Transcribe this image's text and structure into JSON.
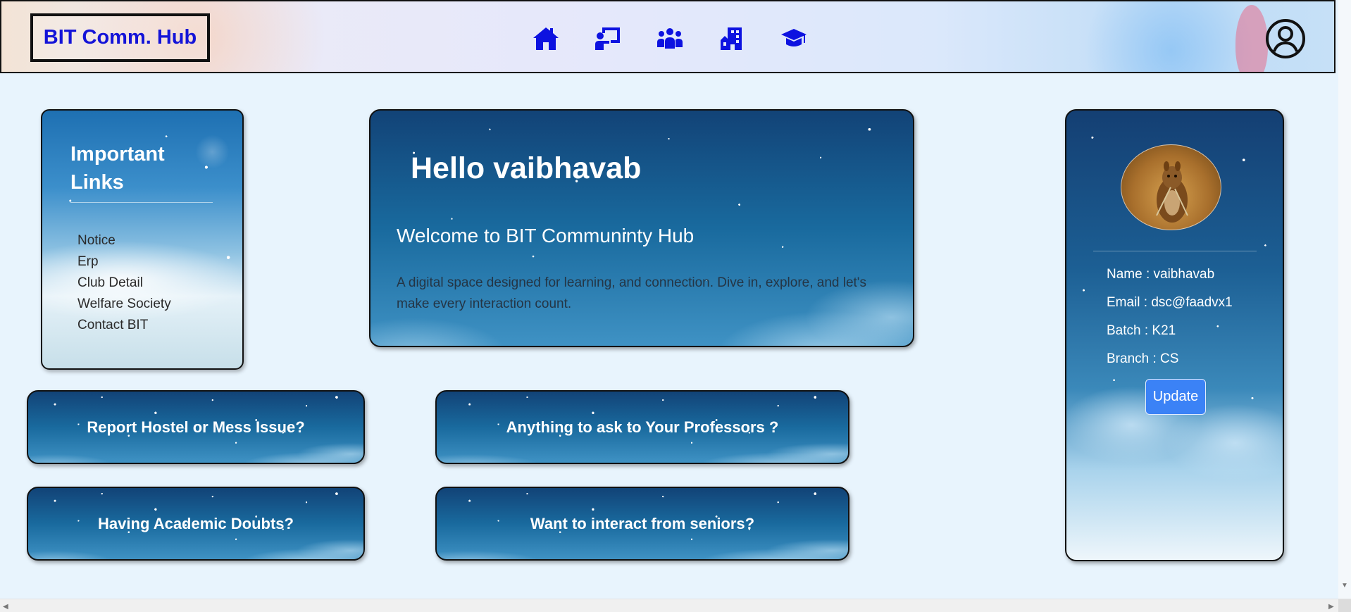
{
  "header": {
    "logo": "BIT Comm. Hub",
    "nav_icons": [
      "home-icon",
      "teacher-board-icon",
      "community-icon",
      "building-icon",
      "graduation-cap-icon"
    ],
    "profile_icon": "user-circle-icon"
  },
  "important_links": {
    "title": "Important Links",
    "items": [
      "Notice",
      "Erp",
      "Club Detail",
      "Welfare Society",
      "Contact BIT"
    ]
  },
  "hello": {
    "greeting": "Hello vaibhavab",
    "welcome": "Welcome to BIT Communinty Hub",
    "description": "A digital space designed for learning, and connection. Dive in, explore, and let's make every interaction count."
  },
  "actions": [
    "Report Hostel or Mess Issue?",
    "Anything to ask to Your Professors ?",
    "Having Academic Doubts?",
    "Want to interact from seniors?"
  ],
  "profile": {
    "name": "Name : vaibhavab",
    "email": "Email : dsc@faadvx1",
    "batch": "Batch : K21",
    "branch": "Branch : CS",
    "update_label": "Update"
  },
  "colors": {
    "logo_text": "#1414d8",
    "nav_icon": "#0d12e0",
    "page_bg": "#e8f4fd",
    "update_button": "#3b82f6"
  }
}
